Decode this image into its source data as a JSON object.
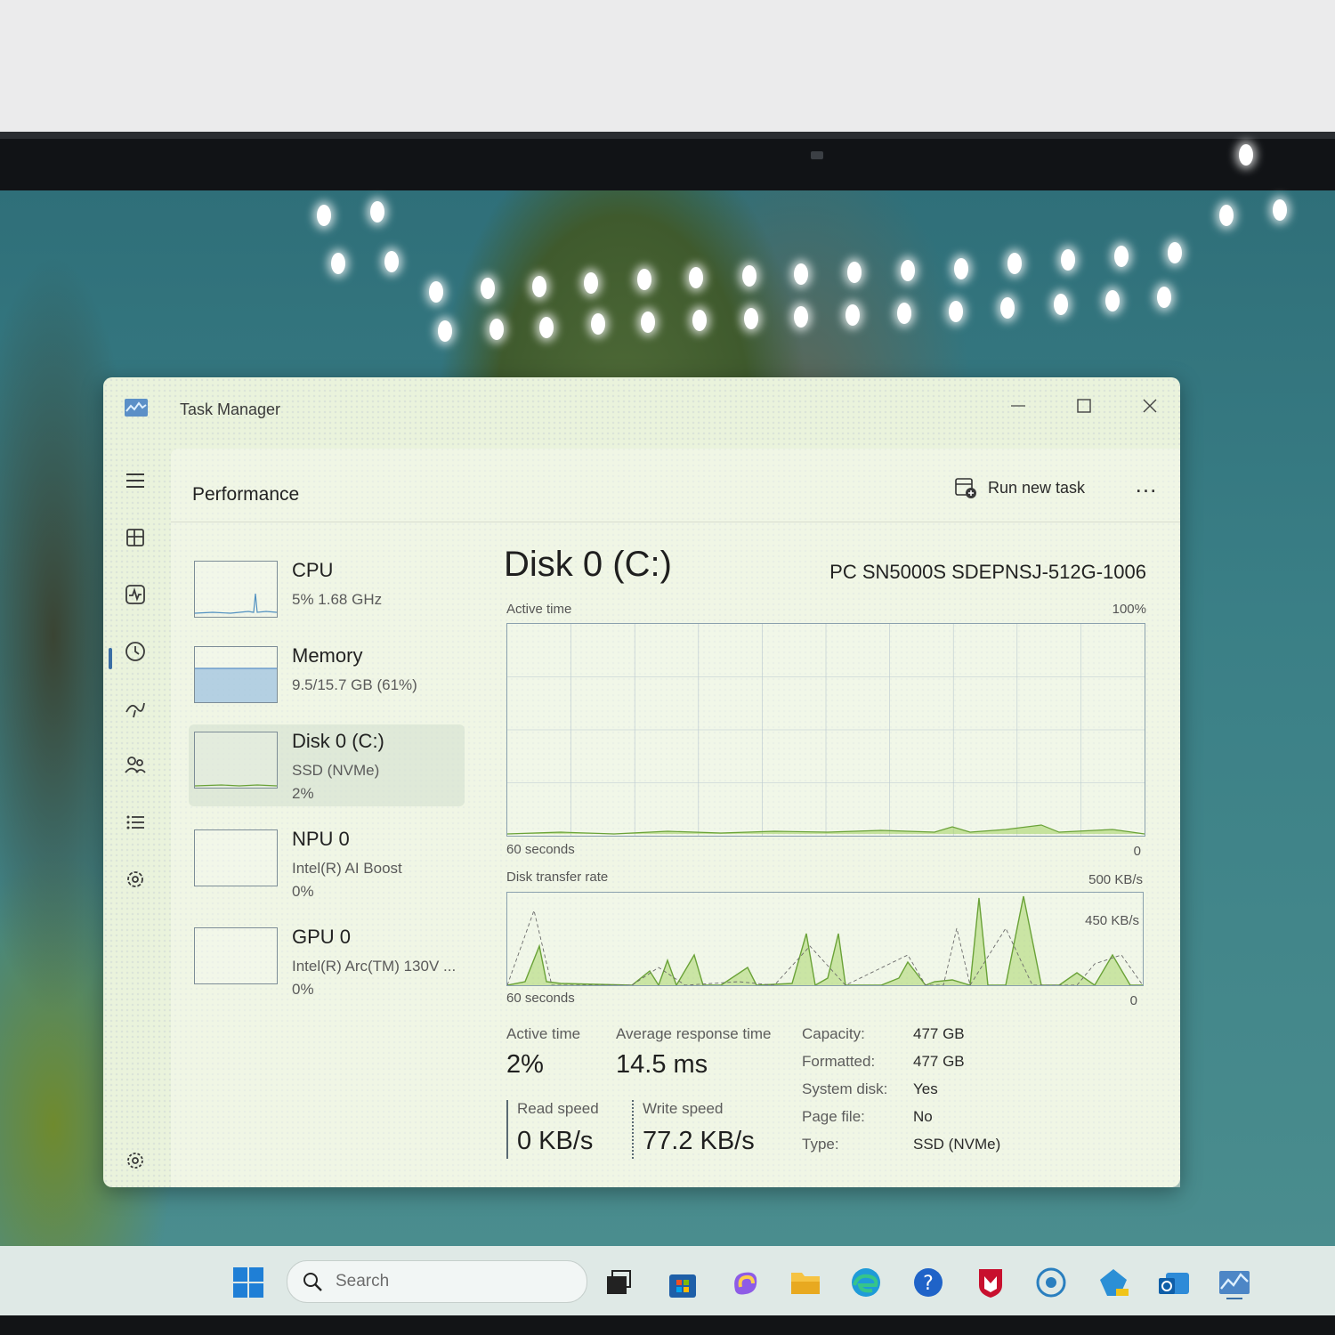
{
  "window": {
    "title": "Task Manager"
  },
  "header": {
    "title": "Performance",
    "run_task_label": "Run new task",
    "more_label": "..."
  },
  "resources": [
    {
      "name": "CPU",
      "sub": "5%  1.68 GHz",
      "sub2": ""
    },
    {
      "name": "Memory",
      "sub": "9.5/15.7 GB (61%)",
      "sub2": ""
    },
    {
      "name": "Disk 0 (C:)",
      "sub": "SSD (NVMe)",
      "sub2": "2%"
    },
    {
      "name": "NPU 0",
      "sub": "Intel(R) AI Boost",
      "sub2": "0%"
    },
    {
      "name": "GPU 0",
      "sub": "Intel(R) Arc(TM) 130V ...",
      "sub2": "0%"
    }
  ],
  "detail": {
    "title": "Disk 0 (C:)",
    "model": "PC SN5000S SDEPNSJ-512G-1006",
    "active_graph": {
      "label": "Active time",
      "max": "100%",
      "time": "60 seconds",
      "min": "0"
    },
    "transfer_graph": {
      "label": "Disk transfer rate",
      "max": "500 KB/s",
      "mid": "450 KB/s",
      "time": "60 seconds",
      "min": "0"
    },
    "stats": {
      "active_time_label": "Active time",
      "active_time_value": "2%",
      "avg_resp_label": "Average response time",
      "avg_resp_value": "14.5 ms",
      "read_label": "Read speed",
      "read_value": "0 KB/s",
      "write_label": "Write speed",
      "write_value": "77.2 KB/s"
    },
    "properties": [
      {
        "key": "Capacity:",
        "value": "477 GB"
      },
      {
        "key": "Formatted:",
        "value": "477 GB"
      },
      {
        "key": "System disk:",
        "value": "Yes"
      },
      {
        "key": "Page file:",
        "value": "No"
      },
      {
        "key": "Type:",
        "value": "SSD (NVMe)"
      }
    ]
  },
  "taskbar": {
    "search_placeholder": "Search"
  },
  "icons": {
    "sidebar": [
      "hamburger-menu-icon",
      "processes-icon",
      "performance-icon",
      "app-history-icon",
      "startup-apps-icon",
      "users-icon",
      "details-icon",
      "services-icon",
      "settings-icon"
    ],
    "taskbar": [
      "start-icon",
      "search-icon",
      "task-view-icon",
      "store-icon",
      "copilot-icon",
      "file-explorer-icon",
      "edge-icon",
      "help-icon",
      "mcafee-icon",
      "app-beta-icon",
      "app-pre-icon",
      "outlook-icon",
      "task-manager-icon"
    ]
  },
  "colors": {
    "accent": "#3a6ea5",
    "graph_line": "#8aa0ad",
    "disk_fill": "#9bcf53",
    "memory_fill": "#9fc3df"
  }
}
